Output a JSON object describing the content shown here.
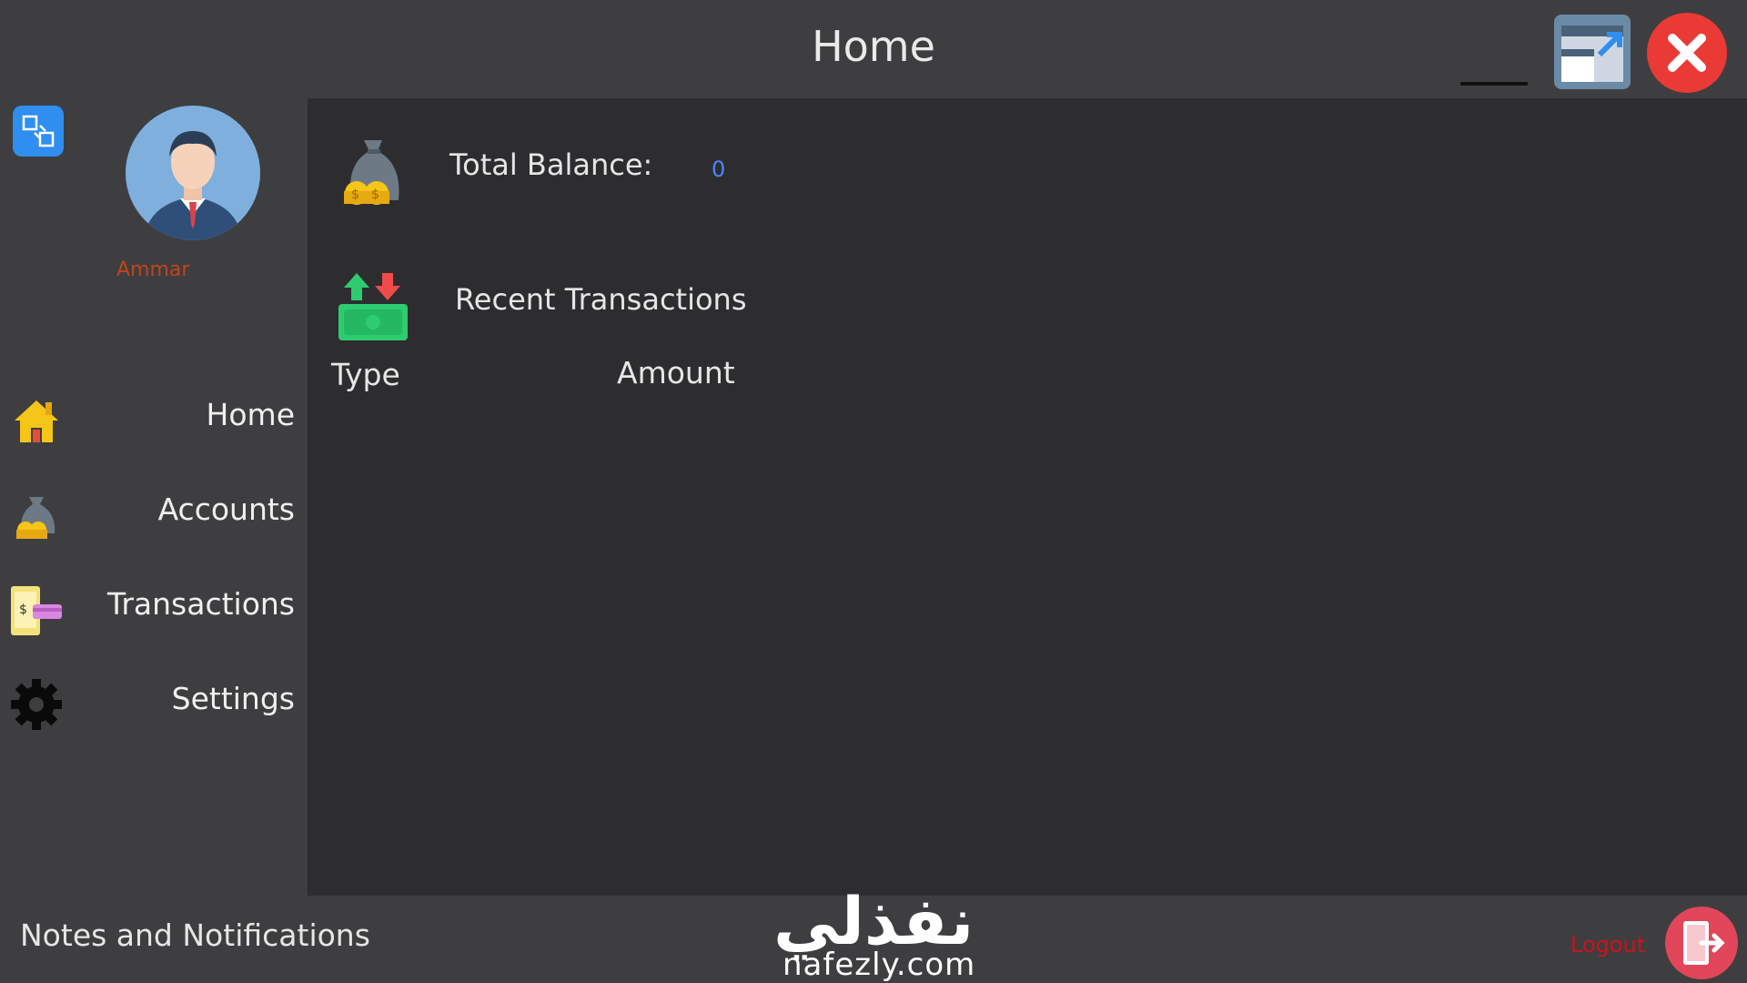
{
  "window": {
    "title": "Home",
    "minimize_icon": "minimize-icon",
    "maximize_icon": "restore-window-icon",
    "close_icon": "close-icon",
    "close_color": "#ea3a35"
  },
  "sidebar": {
    "swap_icon": "swap-icon",
    "avatar_icon": "user-avatar-icon",
    "username": "Ammar",
    "username_color": "#c0451a",
    "items": [
      {
        "label": "Home",
        "icon": "house-icon"
      },
      {
        "label": "Accounts",
        "icon": "money-bag-icon"
      },
      {
        "label": "Transactions",
        "icon": "card-payment-icon"
      },
      {
        "label": "Settings",
        "icon": "gear-icon"
      }
    ]
  },
  "main": {
    "balance_label": "Total Balance:",
    "balance_value": "0",
    "balance_value_color": "#4a86ff",
    "recent_label": "Recent Transactions",
    "columns": {
      "type": "Type",
      "amount": "Amount"
    }
  },
  "footer": {
    "notes_label": "Notes and Notifications",
    "watermark_arabic": "نفذلي",
    "watermark_url": "nafezly.com",
    "logout_label": "Logout",
    "logout_icon": "logout-door-icon"
  }
}
